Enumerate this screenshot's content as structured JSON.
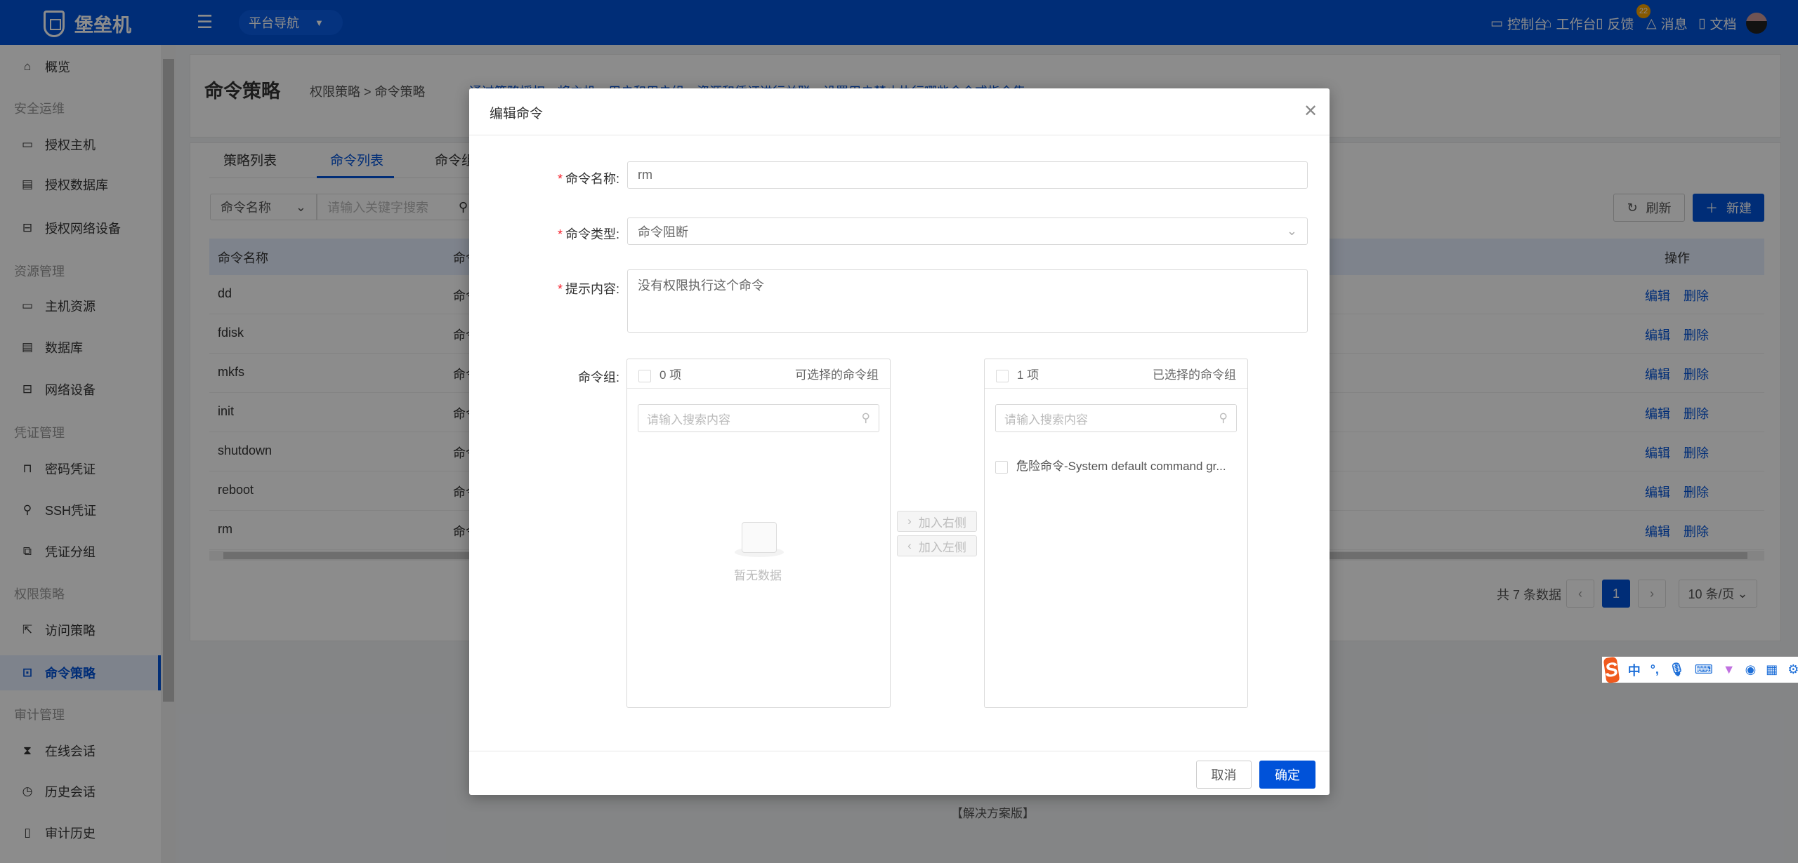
{
  "header": {
    "logo": "堡垒机",
    "platform_nav": "平台导航",
    "nav": [
      {
        "icon": "monitor-icon",
        "label": "控制台"
      },
      {
        "icon": "home-icon",
        "label": "工作台"
      },
      {
        "icon": "feedback-icon",
        "label": "反馈"
      },
      {
        "icon": "bell-icon",
        "label": "消息"
      },
      {
        "icon": "document-icon",
        "label": "文档"
      }
    ],
    "message_badge": "22"
  },
  "sidebar": {
    "entries": [
      {
        "type": "item",
        "icon": "home-icon",
        "glyph": "⌂",
        "label": "概览"
      },
      {
        "type": "section",
        "label": "安全运维"
      },
      {
        "type": "item",
        "icon": "host-icon",
        "glyph": "▭",
        "label": "授权主机"
      },
      {
        "type": "item",
        "icon": "database-icon",
        "glyph": "▤",
        "label": "授权数据库"
      },
      {
        "type": "item",
        "icon": "network-device-icon",
        "glyph": "⊟",
        "label": "授权网络设备"
      },
      {
        "type": "section",
        "label": "资源管理"
      },
      {
        "type": "item",
        "icon": "host-icon",
        "glyph": "▭",
        "label": "主机资源"
      },
      {
        "type": "item",
        "icon": "database-icon",
        "glyph": "▤",
        "label": "数据库"
      },
      {
        "type": "item",
        "icon": "network-device-icon",
        "glyph": "⊟",
        "label": "网络设备"
      },
      {
        "type": "section",
        "label": "凭证管理"
      },
      {
        "type": "item",
        "icon": "lock-icon",
        "glyph": "⊓",
        "label": "密码凭证"
      },
      {
        "type": "item",
        "icon": "key-icon",
        "glyph": "⚲",
        "label": "SSH凭证"
      },
      {
        "type": "item",
        "icon": "group-icon",
        "glyph": "⧉",
        "label": "凭证分组"
      },
      {
        "type": "section",
        "label": "权限策略"
      },
      {
        "type": "item",
        "icon": "access-policy-icon",
        "glyph": "⇱",
        "label": "访问策略"
      },
      {
        "type": "item",
        "icon": "terminal-icon",
        "glyph": "⊡",
        "label": "命令策略",
        "active": true
      },
      {
        "type": "section",
        "label": "审计管理"
      },
      {
        "type": "item",
        "icon": "hourglass-icon",
        "glyph": "⧗",
        "label": "在线会话"
      },
      {
        "type": "item",
        "icon": "clock-icon",
        "glyph": "◷",
        "label": "历史会话"
      },
      {
        "type": "item",
        "icon": "book-icon",
        "glyph": "▯",
        "label": "审计历史"
      }
    ]
  },
  "page": {
    "title": "命令策略",
    "breadcrumb": "权限策略 > 命令策略",
    "description": "通过策略授权，将主机、用户和用户组、资源和凭证进行关联，设置用户禁止执行哪些命令或指令集",
    "tabs": [
      {
        "label": "策略列表"
      },
      {
        "label": "命令列表",
        "active": true
      },
      {
        "label": "命令组"
      }
    ],
    "search_field": "命令名称",
    "search_placeholder": "请输入关键字搜索",
    "refresh": "刷新",
    "create": "新建",
    "table": {
      "columns": [
        "命令名称",
        "命令",
        "操作"
      ],
      "rows": [
        {
          "name": "dd",
          "col2": "命令"
        },
        {
          "name": "fdisk",
          "col2": "命令"
        },
        {
          "name": "mkfs",
          "col2": "命令"
        },
        {
          "name": "init",
          "col2": "命令"
        },
        {
          "name": "shutdown",
          "col2": "命令"
        },
        {
          "name": "reboot",
          "col2": "命令"
        },
        {
          "name": "rm",
          "col2": "命令"
        }
      ],
      "edit": "编辑",
      "delete": "删除"
    },
    "pagination": {
      "total": "共 7 条数据",
      "current": "1",
      "page_size": "10 条/页"
    },
    "footer": "【解决方案版】"
  },
  "modal": {
    "title": "编辑命令",
    "fields": {
      "name_label": "命令名称:",
      "name_value": "rm",
      "type_label": "命令类型:",
      "type_value": "命令阻断",
      "hint_label": "提示内容:",
      "hint_value": "没有权限执行这个命令",
      "group_label": "命令组:"
    },
    "transfer": {
      "left_count": "0 项",
      "left_title": "可选择的命令组",
      "right_count": "1 项",
      "right_title": "已选择的命令组",
      "search_placeholder": "请输入搜索内容",
      "empty": "暂无数据",
      "to_right": "加入右侧",
      "to_left": "加入左侧",
      "right_items": [
        "危险命令-System default command gr..."
      ]
    },
    "cancel": "取消",
    "confirm": "确定"
  },
  "ime": {
    "label": "中"
  },
  "colors": {
    "primary": "#0052d9",
    "required": "#f5222d"
  }
}
